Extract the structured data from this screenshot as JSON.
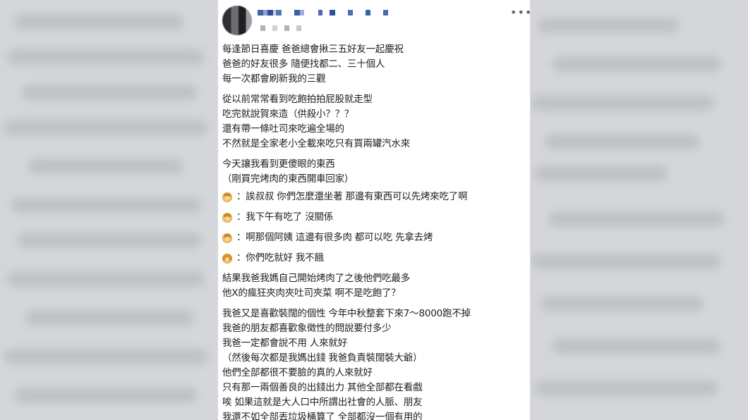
{
  "post": {
    "author_name": "",
    "more_icon": "more-horizontal-icon",
    "more_label": "•••",
    "paragraphs": [
      [
        "每逢節日喜慶 爸爸總會揪三五好友一起慶祝",
        "爸爸的好友很多 隨便找都二、三十個人",
        "每一次都會刷新我的三觀"
      ],
      [
        "從以前常常看到吃飽拍拍屁股就走型",
        "吃完就說賀來造（供殺小？？？",
        "還有帶一條吐司來吃遍全場的",
        "不然就是全家老小全載來吃只有買兩罐汽水來"
      ],
      [
        "今天讓我看到更傻眼的東西",
        "（剛買完烤肉的東西開車回家）"
      ]
    ],
    "dialogue": [
      {
        "icon": "man-emoji-icon",
        "text": "：誒叔叔 你們怎麼還坐著 那邊有東西可以先烤來吃了啊"
      },
      {
        "icon": "man-emoji-icon",
        "text": "：我下午有吃了 沒關係"
      },
      {
        "icon": "man-emoji-icon",
        "text": "：啊那個阿姨 這邊有很多肉 都可以吃 先拿去烤"
      },
      {
        "icon": "woman-emoji-icon",
        "text": "：你們吃就好 我不餓"
      }
    ],
    "paragraphs_after": [
      [
        "結果我爸我媽自己開始烤肉了之後他們吃最多",
        "他X的瘋狂夾肉夾吐司夾菜 啊不是吃飽了？"
      ],
      [
        "我爸又是喜歡裝闊的個性 今年中秋整套下來7～8000跑不掉",
        "我爸的朋友都喜歡象徵性的問說要付多少",
        "我爸一定都會說不用 人來就好",
        "（然後每次都是我媽出錢 我爸負責裝闊裝大爺）",
        "他們全部都很不要臉的真的人來就好",
        "只有那一兩個善良的出錢出力 其他全部都在看戲",
        "唉 如果這就是大人口中所謂出社會的人脈、朋友",
        "我還不如全部丟垃圾桶算了 全部都沒一個有用的"
      ]
    ]
  },
  "colors": {
    "text": "#1c1e21",
    "name_mosaic": "#4a6fb5",
    "background": "#c9cbd0"
  }
}
